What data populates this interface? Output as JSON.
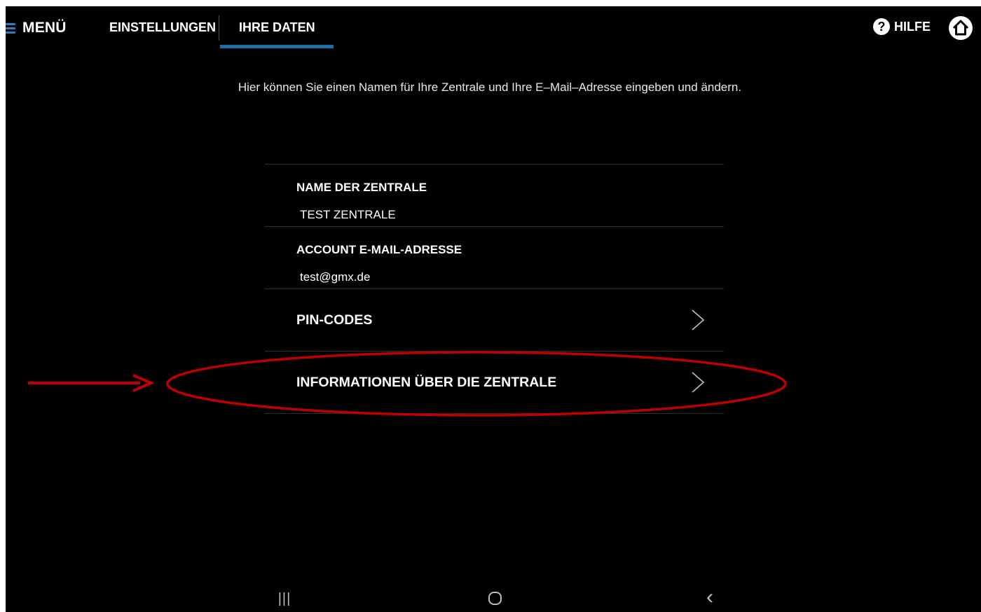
{
  "header": {
    "menu_label": "MENÜ",
    "tabs": [
      {
        "label": "EINSTELLUNGEN",
        "active": false
      },
      {
        "label": "IHRE DATEN",
        "active": true
      }
    ],
    "help_label": "HILFE",
    "help_glyph": "?"
  },
  "intro_text": "Hier können Sie einen Namen für Ihre Zentrale und Ihre E–Mail–Adresse eingeben und ändern.",
  "settings": {
    "central_name": {
      "label": "NAME DER ZENTRALE",
      "value": "TEST ZENTRALE"
    },
    "account_email": {
      "label": "ACCOUNT E-MAIL-ADRESSE",
      "value": "test@gmx.de"
    },
    "pin_codes": {
      "label": "PIN-CODES"
    },
    "central_info": {
      "label": "INFORMATIONEN ÜBER DIE ZENTRALE"
    }
  },
  "system_nav": {
    "recents_glyph": "|||",
    "back_glyph": "‹"
  },
  "colors": {
    "background": "#000000",
    "accent": "#1e6fa4",
    "annotation": "#c00000"
  }
}
